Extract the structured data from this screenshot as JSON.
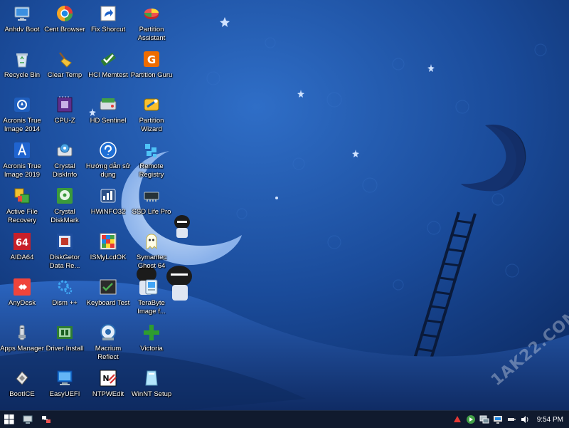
{
  "desktop": {
    "columns": [
      [
        {
          "label": "Anhdv Boot",
          "icon": "monitor-icon"
        },
        {
          "label": "Recycle Bin",
          "icon": "recycle-bin-icon"
        },
        {
          "label": "Acronis True Image 2014",
          "icon": "acronis-2014-icon"
        },
        {
          "label": "Acronis True Image 2019",
          "icon": "acronis-2019-icon"
        },
        {
          "label": "Active File Recovery",
          "icon": "file-recovery-icon"
        },
        {
          "label": "AIDA64",
          "icon": "aida64-icon"
        },
        {
          "label": "AnyDesk",
          "icon": "anydesk-icon"
        },
        {
          "label": "Apps Manager",
          "icon": "apps-manager-icon"
        },
        {
          "label": "BootICE",
          "icon": "bootice-icon"
        }
      ],
      [
        {
          "label": "Cent Browser",
          "icon": "cent-browser-icon"
        },
        {
          "label": "Clear Temp",
          "icon": "broom-icon"
        },
        {
          "label": "CPU-Z",
          "icon": "cpuz-icon"
        },
        {
          "label": "Crystal DiskInfo",
          "icon": "crystaldiskinfo-icon"
        },
        {
          "label": "Crystal DiskMark",
          "icon": "crystaldiskmark-icon"
        },
        {
          "label": "DiskGetor Data Re...",
          "icon": "diskgetor-icon"
        },
        {
          "label": "Dism ++",
          "icon": "dism-icon"
        },
        {
          "label": "Driver Install",
          "icon": "driver-install-icon"
        },
        {
          "label": "EasyUEFI",
          "icon": "easyuefi-icon"
        }
      ],
      [
        {
          "label": "Fix Shorcut",
          "icon": "shortcut-icon"
        },
        {
          "label": "HCI Memtest",
          "icon": "memtest-icon"
        },
        {
          "label": "HD Sentinel",
          "icon": "hd-sentinel-icon"
        },
        {
          "label": "Hướng dẫn sử dụng",
          "icon": "help-icon"
        },
        {
          "label": "HWiNFO32",
          "icon": "hwinfo-icon"
        },
        {
          "label": "ISMyLcdOK",
          "icon": "ismylcdok-icon"
        },
        {
          "label": "Keyboard Test",
          "icon": "keyboard-test-icon"
        },
        {
          "label": "Macrium Reflect",
          "icon": "macrium-icon"
        },
        {
          "label": "NTPWEdit",
          "icon": "ntpwedit-icon"
        }
      ],
      [
        {
          "label": "Partition Assistant",
          "icon": "partition-assistant-icon"
        },
        {
          "label": "Partition Guru",
          "icon": "partition-guru-icon"
        },
        {
          "label": "Partition Wizard",
          "icon": "partition-wizard-icon"
        },
        {
          "label": "Remote Registry",
          "icon": "remote-registry-icon"
        },
        {
          "label": "SSD Life Pro",
          "icon": "ssd-icon"
        },
        {
          "label": "Symantec Ghost 64",
          "icon": "ghost-icon"
        },
        {
          "label": "TeraByte Image f...",
          "icon": "terabyte-icon"
        },
        {
          "label": "Victoria",
          "icon": "victoria-icon"
        },
        {
          "label": "WinNT Setup",
          "icon": "winnt-setup-icon"
        }
      ]
    ]
  },
  "taskbar": {
    "start_icon": "windows-logo-icon",
    "pinned": [
      {
        "icon": "this-pc-icon"
      },
      {
        "icon": "network-icon"
      }
    ],
    "tray": [
      {
        "icon": "red-arrow-icon"
      },
      {
        "icon": "play-icon"
      },
      {
        "icon": "network-adapter-icon"
      },
      {
        "icon": "display-icon"
      },
      {
        "icon": "usb-icon"
      },
      {
        "icon": "speaker-icon"
      }
    ],
    "clock": "9:54 PM"
  },
  "watermark": "1AK22.COM"
}
